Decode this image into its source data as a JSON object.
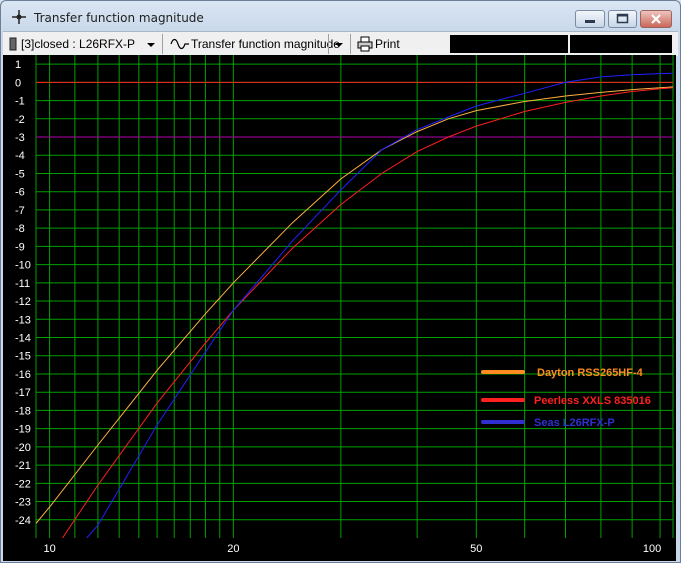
{
  "window": {
    "title": "Transfer function magnitude"
  },
  "toolbar": {
    "source_label": "[3]closed : L26RFX-P",
    "view_label": "Transfer function magnitude",
    "print_label": "Print"
  },
  "colors": {
    "background": "#000000",
    "grid": "#00a000",
    "axis_text": "#ffffff",
    "reference_0db": "#ff2020",
    "reference_3db": "#b000b0"
  },
  "chart_data": {
    "type": "line",
    "title": "",
    "xlabel": "",
    "ylabel": "",
    "x_scale": "log",
    "xlim": [
      9.5,
      105
    ],
    "ylim": [
      -25,
      1.5
    ],
    "x_ticks": [
      10,
      20,
      50,
      100
    ],
    "y_ticks": [
      1,
      0,
      -1,
      -2,
      -3,
      -4,
      -5,
      -6,
      -7,
      -8,
      -9,
      -10,
      -11,
      -12,
      -13,
      -14,
      -15,
      -16,
      -17,
      -18,
      -19,
      -20,
      -21,
      -22,
      -23,
      -24
    ],
    "reference_lines": [
      0,
      -3
    ],
    "grid": true,
    "legend_position": "right",
    "series": [
      {
        "name": "Dayton RSS265HF-4",
        "color": "#ffb040",
        "legend_color": "#ff8c20",
        "x": [
          9.5,
          10,
          12,
          15,
          18,
          20,
          25,
          30,
          35,
          40,
          45,
          50,
          60,
          70,
          80,
          90,
          100,
          105
        ],
        "y": [
          -24.2,
          -23.3,
          -19.9,
          -15.8,
          -12.7,
          -11.0,
          -7.7,
          -5.3,
          -3.7,
          -2.7,
          -2.0,
          -1.55,
          -1.05,
          -0.75,
          -0.55,
          -0.4,
          -0.3,
          -0.25
        ]
      },
      {
        "name": "Peerless XXLS 835016",
        "color": "#ff2020",
        "legend_color": "#ff2020",
        "x": [
          10.5,
          12,
          15,
          18,
          20,
          25,
          30,
          35,
          40,
          45,
          50,
          60,
          70,
          80,
          90,
          100,
          105
        ],
        "y": [
          -25,
          -22.1,
          -17.6,
          -14.3,
          -12.5,
          -9.1,
          -6.7,
          -5.0,
          -3.8,
          -3.0,
          -2.4,
          -1.6,
          -1.1,
          -0.75,
          -0.5,
          -0.35,
          -0.3
        ]
      },
      {
        "name": "Seas L26RFX-P",
        "color": "#2020ff",
        "legend_color": "#3030d0",
        "x": [
          11.5,
          12,
          15,
          18,
          20,
          25,
          30,
          35,
          40,
          45,
          50,
          60,
          70,
          80,
          90,
          100,
          105
        ],
        "y": [
          -25,
          -24.3,
          -18.8,
          -14.8,
          -12.5,
          -8.7,
          -5.9,
          -3.7,
          -2.6,
          -1.9,
          -1.3,
          -0.6,
          0.0,
          0.3,
          0.42,
          0.48,
          0.5
        ]
      }
    ]
  }
}
